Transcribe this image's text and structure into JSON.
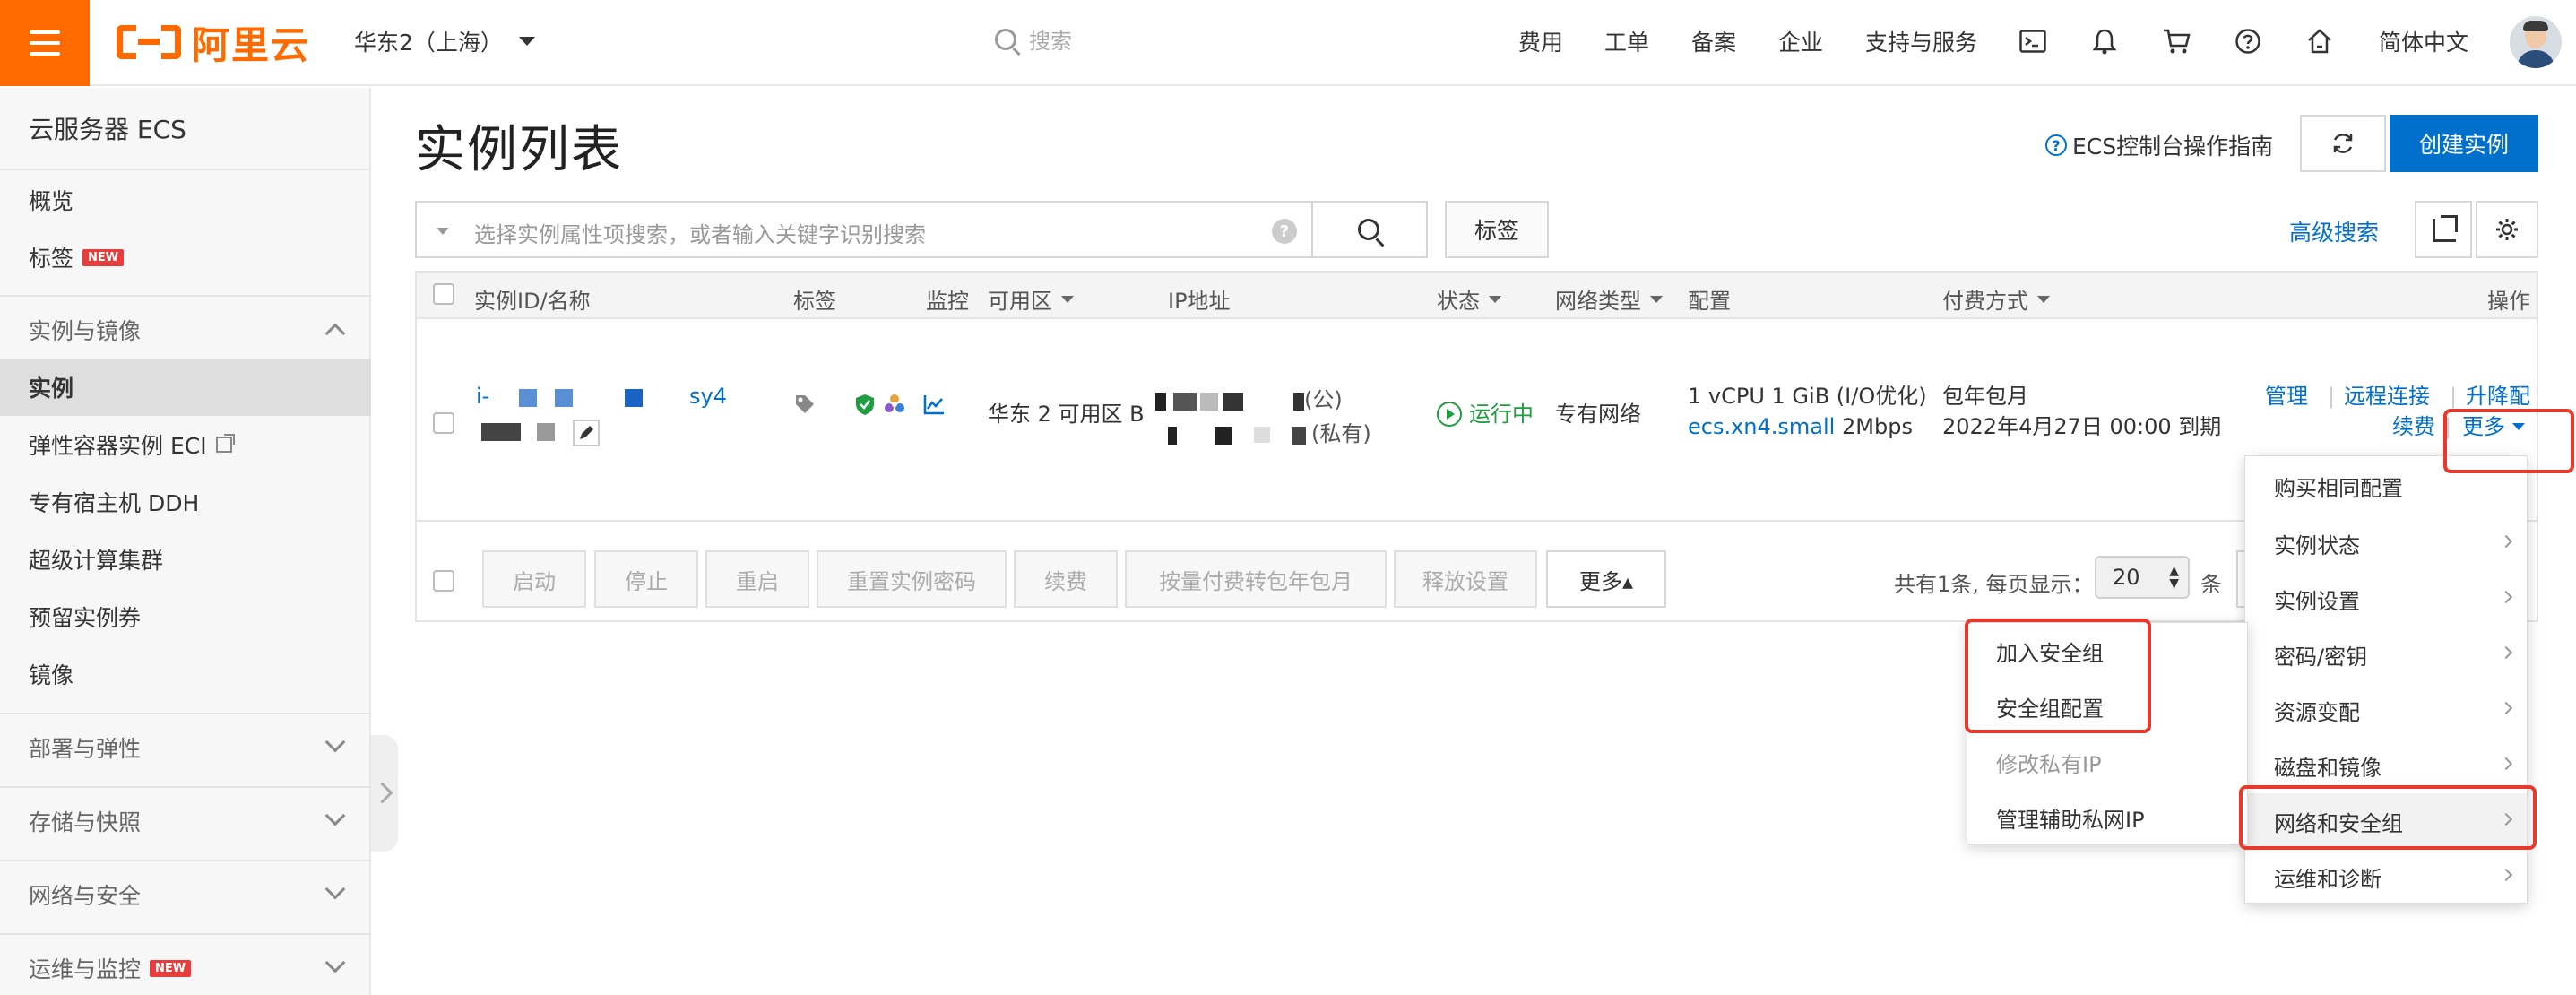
{
  "header": {
    "logo_text": "阿里云",
    "region": "华东2（上海）",
    "search_placeholder": "搜索",
    "nav": [
      "费用",
      "工单",
      "备案",
      "企业",
      "支持与服务"
    ],
    "language": "简体中文"
  },
  "sidebar": {
    "title": "云服务器 ECS",
    "items": [
      {
        "label": "概览"
      },
      {
        "label": "标签",
        "badge": "NEW"
      },
      {
        "label": "实例与镜像",
        "group": true
      },
      {
        "label": "实例",
        "active": true
      },
      {
        "label": "弹性容器实例 ECI"
      },
      {
        "label": "专有宿主机 DDH"
      },
      {
        "label": "超级计算集群"
      },
      {
        "label": "预留实例券"
      },
      {
        "label": "镜像"
      },
      {
        "label": "部署与弹性",
        "group": true
      },
      {
        "label": "存储与快照",
        "group": true
      },
      {
        "label": "网络与安全",
        "group": true
      },
      {
        "label": "运维与监控",
        "group": true,
        "badge": "NEW"
      }
    ]
  },
  "main": {
    "title": "实例列表",
    "guide_link": "ECS控制台操作指南",
    "create_button": "创建实例",
    "filter_placeholder": "选择实例属性项搜索，或者输入关键字识别搜索",
    "tag_button": "标签",
    "advanced_search": "高级搜索",
    "columns": [
      "实例ID/名称",
      "标签",
      "监控",
      "可用区",
      "IP地址",
      "状态",
      "网络类型",
      "配置",
      "付费方式",
      "操作"
    ],
    "row": {
      "id_prefix": "i-",
      "id_suffix": "sy4",
      "zone": "华东 2 可用区 B",
      "ip_public_suffix": "(公)",
      "ip_private_suffix": "(私有)",
      "status": "运行中",
      "network": "专有网络",
      "config_line1": "1 vCPU 1 GiB (I/O优化)",
      "instance_type": "ecs.xn4.small",
      "bandwidth": "2Mbps",
      "billing": "包年包月",
      "expiry": "2022年4月27日 00:00 到期",
      "actions": {
        "manage": "管理",
        "remote": "远程连接",
        "upgrade": "升降配",
        "renew": "续费",
        "more": "更多"
      }
    },
    "bulk_buttons": [
      "启动",
      "停止",
      "重启",
      "重置实例密码",
      "续费",
      "按量付费转包年包月",
      "释放设置"
    ],
    "bulk_more": "更多▴",
    "pager_text": "共有1条, 每页显示：",
    "page_size": "20",
    "pager_unit": "条"
  },
  "more_menu": {
    "items": [
      "购买相同配置",
      "实例状态",
      "实例设置",
      "密码/密钥",
      "资源变配",
      "磁盘和镜像",
      "网络和安全组",
      "运维和诊断"
    ]
  },
  "sub_menu": {
    "items": [
      "加入安全组",
      "安全组配置",
      "修改私有IP",
      "管理辅助私网IP"
    ],
    "disabled": [
      "修改私有IP"
    ]
  },
  "colors": {
    "accent": "#ff6a00",
    "primary": "#0070cc",
    "running": "#1e9e3e",
    "highlight": "#e8392c"
  }
}
